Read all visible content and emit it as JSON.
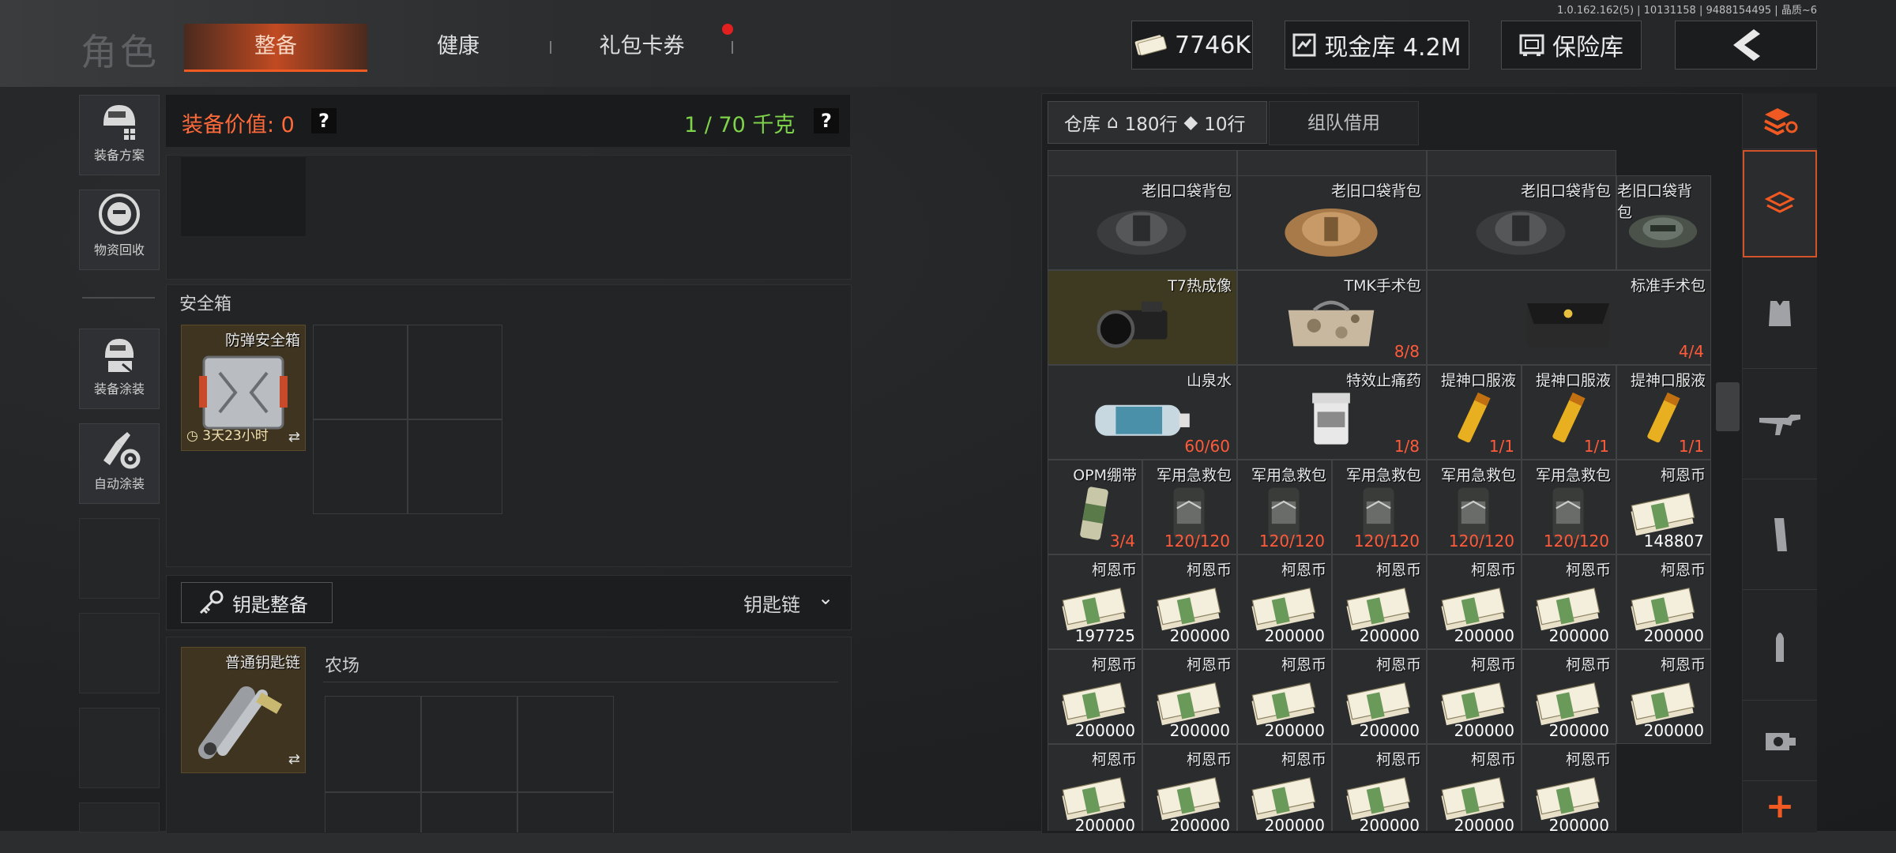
{
  "version": "1.0.162.162(5) | 10131158 | 9488154495 | 晶质~6",
  "header": {
    "title": "角色",
    "tabs": [
      {
        "label": "整备",
        "active": true
      },
      {
        "label": "健康",
        "active": false
      },
      {
        "label": "礼包卡券",
        "active": false
      }
    ],
    "cash": "7746K",
    "vault": "现金库 4.2M",
    "insurance": "保险库"
  },
  "sidebar": [
    {
      "label": "装备方案",
      "icon": "helmet-grid-icon"
    },
    {
      "label": "物资回收",
      "icon": "recycle-face-icon"
    },
    {
      "label": "装备涂装",
      "icon": "helmet-paint-icon"
    },
    {
      "label": "自动涂装",
      "icon": "brush-gear-icon"
    }
  ],
  "equipment": {
    "value_label": "装备价值: 0",
    "weight_label": "1 / 70 千克",
    "safebox_title": "安全箱",
    "safebox_item_name": "防弹安全箱",
    "safebox_timer": "3天23小时",
    "key_button": "钥匙整备",
    "key_chain_label": "钥匙链",
    "key_item_name": "普通钥匙链",
    "key_area_label": "农场"
  },
  "storage": {
    "tab_warehouse": "仓库",
    "rows_home": "180行",
    "rows_tag": "10行",
    "tab_team": "组队借用",
    "items": [
      {
        "name": "老旧口袋背包",
        "count": "",
        "kind": "bag-dark"
      },
      {
        "name": "老旧口袋背包",
        "count": "",
        "kind": "bag-tan"
      },
      {
        "name": "老旧口袋背包",
        "count": "",
        "kind": "bag-dark"
      },
      {
        "name": "老旧口袋背包",
        "count": "",
        "kind": "bag-green"
      },
      {
        "name": "T7热成像",
        "count": "",
        "kind": "scope"
      },
      {
        "name": "TMK手术包",
        "count": "8/8",
        "kind": "camo-bag"
      },
      {
        "name": "标准手术包",
        "count": "4/4",
        "kind": "pouch"
      },
      {
        "name": "山泉水",
        "count": "60/60",
        "kind": "bottle"
      },
      {
        "name": "特效止痛药",
        "count": "1/8",
        "kind": "pill"
      },
      {
        "name": "提神口服液",
        "count": "1/1",
        "kind": "tube"
      },
      {
        "name": "提神口服液",
        "count": "1/1",
        "kind": "tube"
      },
      {
        "name": "提神口服液",
        "count": "1/1",
        "kind": "tube"
      },
      {
        "name": "OPM绷带",
        "count": "3/4",
        "kind": "bandage"
      },
      {
        "name": "军用急救包",
        "count": "120/120",
        "kind": "medkit"
      },
      {
        "name": "军用急救包",
        "count": "120/120",
        "kind": "medkit"
      },
      {
        "name": "军用急救包",
        "count": "120/120",
        "kind": "medkit"
      },
      {
        "name": "军用急救包",
        "count": "120/120",
        "kind": "medkit"
      },
      {
        "name": "军用急救包",
        "count": "120/120",
        "kind": "medkit"
      },
      {
        "name": "柯恩币",
        "count": "148807",
        "kind": "cash"
      },
      {
        "name": "柯恩币",
        "count": "197725",
        "kind": "cash"
      },
      {
        "name": "柯恩币",
        "count": "200000",
        "kind": "cash"
      },
      {
        "name": "柯恩币",
        "count": "200000",
        "kind": "cash"
      },
      {
        "name": "柯恩币",
        "count": "200000",
        "kind": "cash"
      },
      {
        "name": "柯恩币",
        "count": "200000",
        "kind": "cash"
      },
      {
        "name": "柯恩币",
        "count": "200000",
        "kind": "cash"
      },
      {
        "name": "柯恩币",
        "count": "200000",
        "kind": "cash"
      },
      {
        "name": "柯恩币",
        "count": "200000",
        "kind": "cash"
      },
      {
        "name": "柯恩币",
        "count": "200000",
        "kind": "cash"
      },
      {
        "name": "柯恩币",
        "count": "200000",
        "kind": "cash"
      },
      {
        "name": "柯恩币",
        "count": "200000",
        "kind": "cash"
      },
      {
        "name": "柯恩币",
        "count": "200000",
        "kind": "cash"
      },
      {
        "name": "柯恩币",
        "count": "200000",
        "kind": "cash"
      },
      {
        "name": "柯恩币",
        "count": "200000",
        "kind": "cash"
      },
      {
        "name": "柯恩币",
        "count": "200000",
        "kind": "cash"
      },
      {
        "name": "柯恩币",
        "count": "200000",
        "kind": "cash"
      },
      {
        "name": "柯恩币",
        "count": "200000",
        "kind": "cash"
      },
      {
        "name": "柯恩币",
        "count": "200000",
        "kind": "cash"
      },
      {
        "name": "柯恩币",
        "count": "200000",
        "kind": "cash"
      },
      {
        "name": "柯恩币",
        "count": "200000",
        "kind": "cash"
      }
    ]
  },
  "right_rail": [
    {
      "icon": "layers-refresh-icon"
    },
    {
      "icon": "layers-icon",
      "active": true
    },
    {
      "icon": "vest-icon"
    },
    {
      "icon": "rifle-icon"
    },
    {
      "icon": "magazine-icon"
    },
    {
      "icon": "bullet-icon"
    },
    {
      "icon": "scope-mount-icon"
    },
    {
      "icon": "plus-icon"
    }
  ],
  "colors": {
    "accent": "#f05a22",
    "value_text": "#ff6a3a",
    "weight_text": "#7ed34a",
    "count_text": "#ff5a3a"
  }
}
